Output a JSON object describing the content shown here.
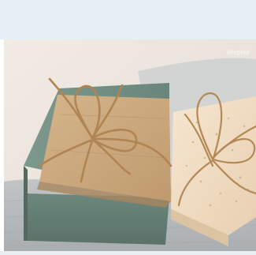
{
  "photo": {
    "watermark": "#hcpind",
    "subject": "soap-bars-with-twine"
  },
  "colors": {
    "page_band": "#e6eef6",
    "background": "#ede7df",
    "towel": "#b9bcbf",
    "green_soap": "#6f8a7f",
    "kraft_paper": "#c9a57c",
    "cream_soap": "#efd9bf",
    "twine": "#b48955"
  }
}
